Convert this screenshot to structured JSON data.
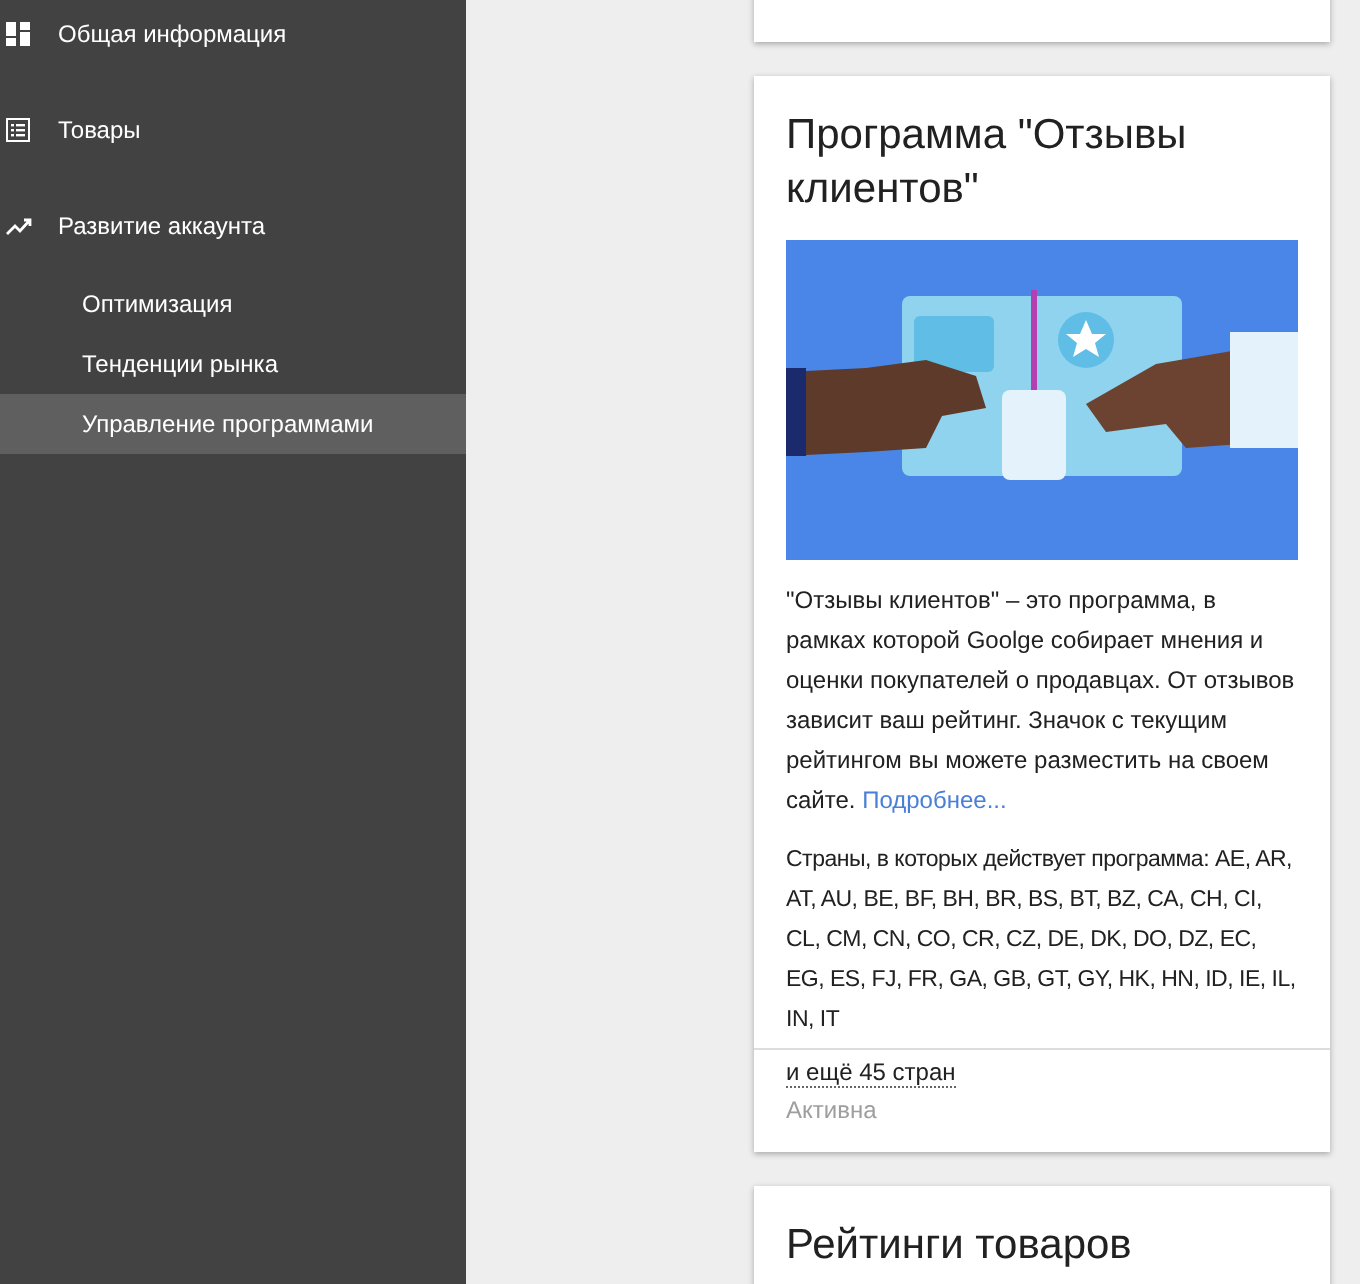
{
  "sidebar": {
    "items": [
      {
        "label": "Общая информация",
        "kind": "dashboard",
        "selected": false
      },
      {
        "label": "Товары",
        "kind": "list",
        "selected": false
      },
      {
        "label": "Развитие аккаунта",
        "kind": "trend",
        "selected": false,
        "children": [
          {
            "label": "Оптимизация",
            "selected": false
          },
          {
            "label": "Тенденции рынка",
            "selected": false
          },
          {
            "label": "Управление программами",
            "selected": true
          }
        ]
      }
    ]
  },
  "cards": [
    {
      "kind": "hidden"
    },
    {
      "kind": "program",
      "title": "Программа \"Отзывы клиентов\"",
      "description": "\"Отзывы клиентов\" – это программа, в рамках которой Goolge собирает мнения и оценки покупателей о продавцах. От отзывов зависит ваш рейтинг. Значок с текущим рейтингом вы можете разместить на своем сайте.",
      "link": "Подробнее...",
      "countries": "Страны, в которых действует программа: AE, AR, AT, AU, BE, BF, BH, BR, BS, BT, BZ, CA, CH, CI, CL, CM, CN, CO, CR, CZ, DE, DK, DO, DZ, EC, EG, ES, FJ, FR, GA, GB, GT, GY, HK, HN, ID, IE, IL, IN, IT",
      "more": "и ещё 45 стран",
      "status": "Активна"
    },
    {
      "kind": "program_partial",
      "title": "Рейтинги товаров"
    }
  ]
}
